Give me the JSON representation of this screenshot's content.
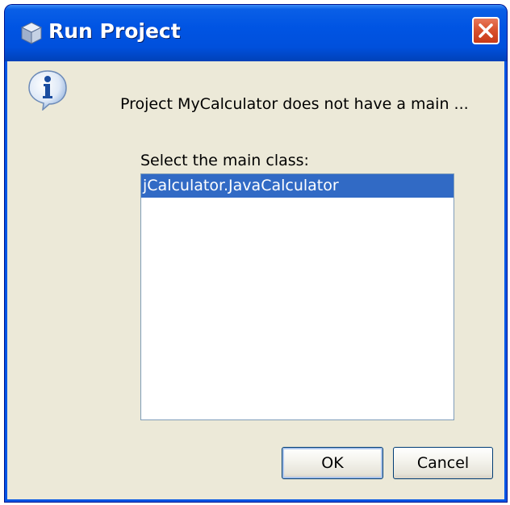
{
  "window": {
    "title": "Run Project"
  },
  "dialog": {
    "message": "Project MyCalculator does not have a main ...",
    "select_label": "Select the main class:",
    "classes": [
      {
        "label": "jCalculator.JavaCalculator",
        "selected": true
      }
    ]
  },
  "buttons": {
    "ok_label": "OK",
    "cancel_label": "Cancel"
  },
  "icons": {
    "title": "project-cube-icon",
    "close": "close-icon",
    "info": "info-icon"
  },
  "colors": {
    "titlebar": "#0054e3",
    "close_button": "#d9532f",
    "dialog_background": "#ece9d8",
    "selection": "#316ac5",
    "list_border": "#7f9db9"
  }
}
